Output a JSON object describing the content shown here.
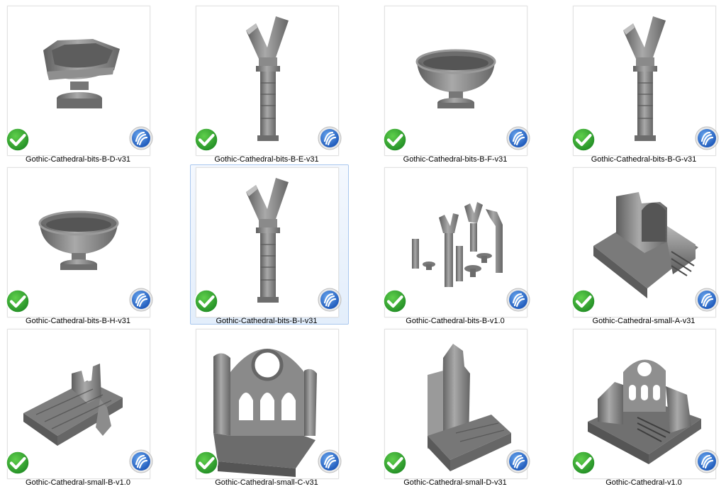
{
  "files": [
    {
      "name": "Gothic-Cathedral-bits-B-D-v31",
      "model": "broken-bowl-icon",
      "selected": false
    },
    {
      "name": "Gothic-Cathedral-bits-B-E-v31",
      "model": "column-arch-icon",
      "selected": false
    },
    {
      "name": "Gothic-Cathedral-bits-B-F-v31",
      "model": "bowl-icon",
      "selected": false
    },
    {
      "name": "Gothic-Cathedral-bits-B-G-v31",
      "model": "column-arch-icon",
      "selected": false
    },
    {
      "name": "Gothic-Cathedral-bits-B-H-v31",
      "model": "bowl-icon",
      "selected": false
    },
    {
      "name": "Gothic-Cathedral-bits-B-I-v31",
      "model": "column-arch-icon",
      "selected": true
    },
    {
      "name": "Gothic-Cathedral-bits-B-v1.0",
      "model": "parts-set-icon",
      "selected": false
    },
    {
      "name": "Gothic-Cathedral-small-A-v31",
      "model": "ruin-stairs-icon",
      "selected": false
    },
    {
      "name": "Gothic-Cathedral-small-B-v1.0",
      "model": "ruin-floor-icon",
      "selected": false
    },
    {
      "name": "Gothic-Cathedral-small-C-v31",
      "model": "window-arch-icon",
      "selected": false
    },
    {
      "name": "Gothic-Cathedral-small-D-v31",
      "model": "ruin-wall-icon",
      "selected": false
    },
    {
      "name": "Gothic-Cathedral-v1.0",
      "model": "cathedral-icon",
      "selected": false
    }
  ],
  "status_overlay": "sync-ok-check-icon",
  "app_overlay": "app-badge-icon",
  "colors": {
    "selection_bg": "#e3eefb",
    "selection_border": "#a9c7ee",
    "model_gray": "#8a8a8a",
    "check_green": "#2fa12f",
    "badge_blue": "#2a6fd1"
  }
}
